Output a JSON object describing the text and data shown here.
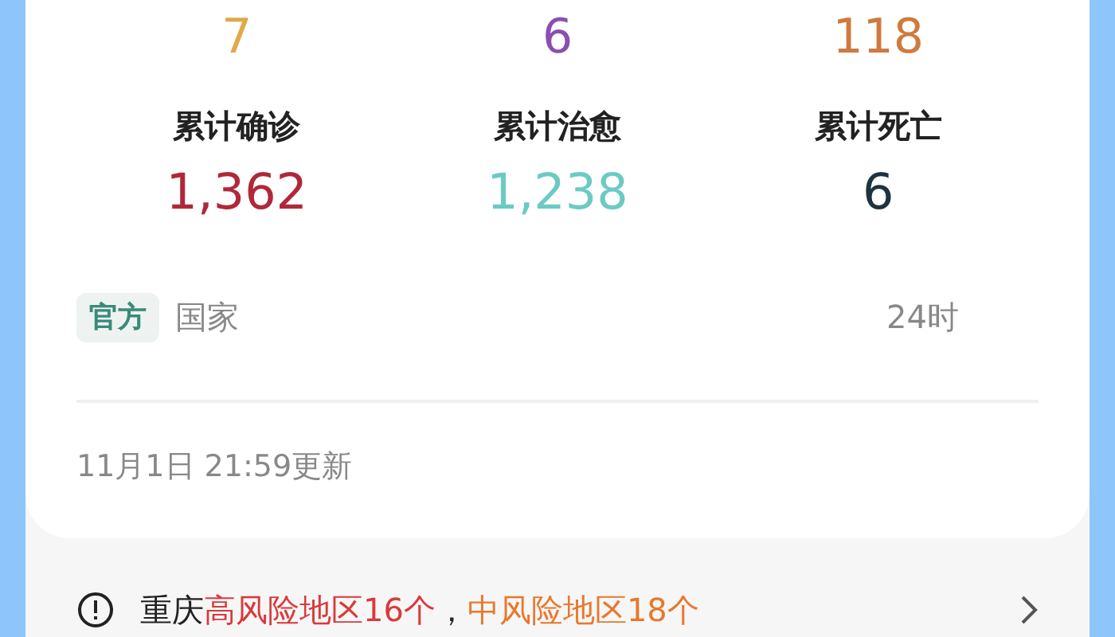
{
  "new_counts": [
    {
      "value": "7",
      "color": "#e0a94a"
    },
    {
      "value": "6",
      "color": "#8a4fb0"
    },
    {
      "value": "118",
      "color": "#cf7a3e"
    }
  ],
  "totals": [
    {
      "label": "累计确诊",
      "value": "1,362",
      "color": "#b0283a"
    },
    {
      "label": "累计治愈",
      "value": "1,238",
      "color": "#6ccac4"
    },
    {
      "label": "累计死亡",
      "value": "6",
      "color": "#1d3340"
    }
  ],
  "source": {
    "badge": "官方",
    "text_start": "国家",
    "text_end": "24时"
  },
  "updated": "11月1日 21:59更新",
  "risk_notice": {
    "place": "重庆",
    "high_risk": "高风险地区16个",
    "separator": "，",
    "medium_risk": "中风险地区18个"
  }
}
